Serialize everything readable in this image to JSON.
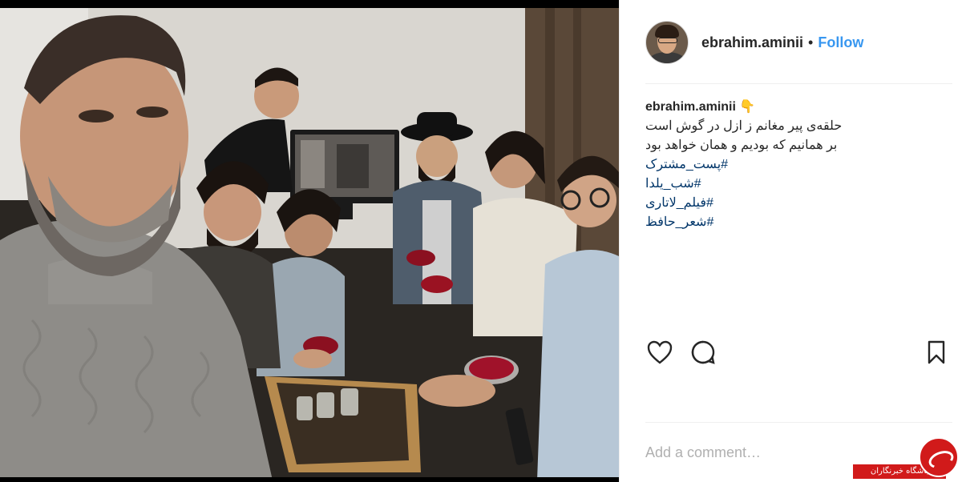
{
  "post": {
    "username": "ebrahim.aminii",
    "separator": "•",
    "follow_label": "Follow",
    "caption_username": "ebrahim.aminii",
    "caption_emoji": "👇",
    "caption_lines": [
      "حلقه‌ی پیر مغانم ز ازل در گوش است",
      "بر همانیم که بودیم و همان خواهد بود"
    ],
    "hashtags": [
      "#پست_مشترک",
      "#شب_یلدا",
      "#فیلم_لاتاری",
      "#شعر_حافظ"
    ]
  },
  "icons": {
    "like": "heart-icon",
    "comment": "comment-bubble-icon",
    "save": "bookmark-icon"
  },
  "comment_box": {
    "placeholder": "Add a comment…",
    "value": ""
  },
  "watermark": {
    "text": "باشگاه خبرنگاران"
  },
  "colors": {
    "accent": "#3897f0",
    "hashtag": "#003569",
    "text": "#262626",
    "watermark": "#d11a1a"
  }
}
